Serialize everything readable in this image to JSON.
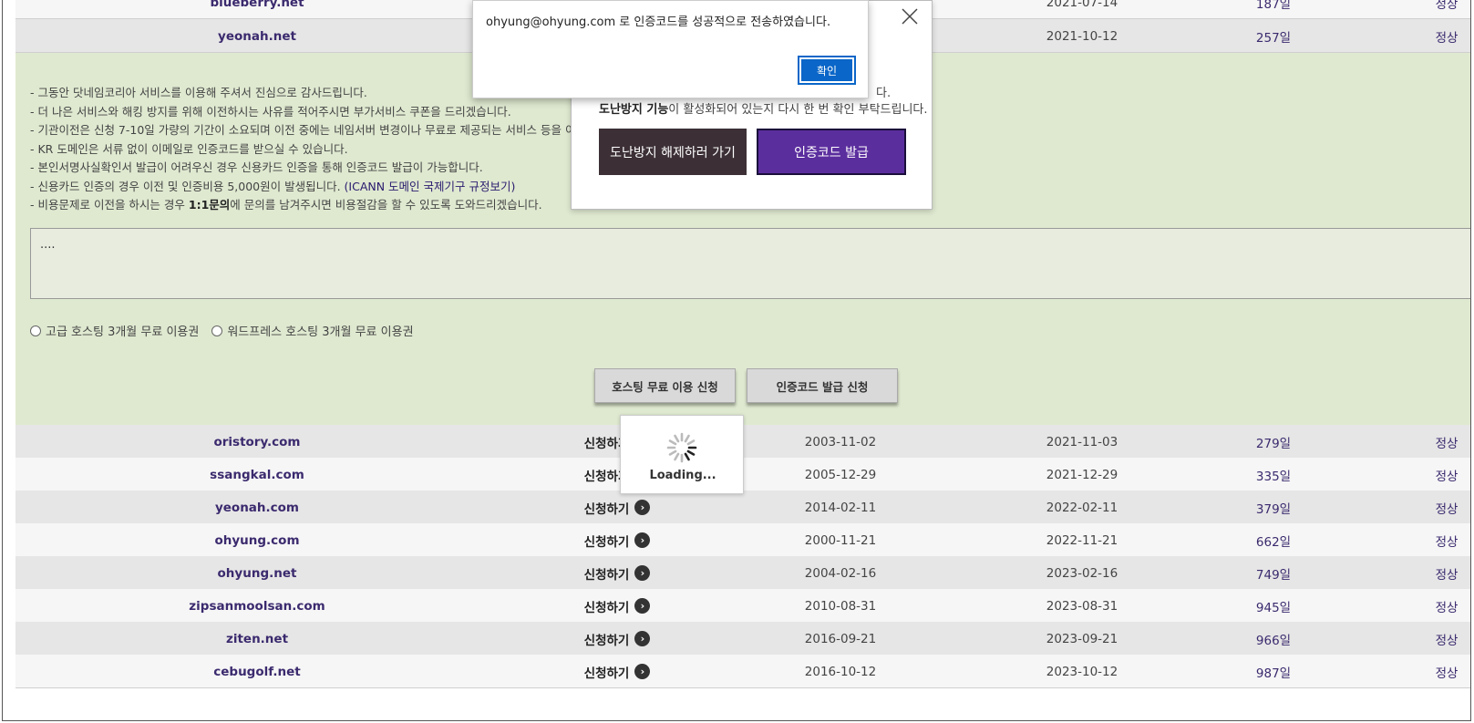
{
  "top_rows": [
    {
      "domain": "blueberry.net",
      "expire": "2021-07-14",
      "days": "187일",
      "status": "정상"
    },
    {
      "domain": "yeonah.net",
      "expire": "2021-10-12",
      "days": "257일",
      "status": "정상"
    }
  ],
  "notice": {
    "lines": [
      "- 그동안 닷네임코리아 서비스를 이용해 주셔서 진심으로 감사드립니다.",
      "- 더 나은 서비스와 해킹 방지를 위해 이전하시는 사유를 적어주시면 부가서비스 쿠폰을 드리겠습니다.",
      "- 기관이전은 신청 7-10일 가량의 기간이 소요되며 이전 중에는 네임서버 변경이나 무료로 제공되는 서비스 등을 이용할",
      "- KR 도메인은 서류 없이 이메일로 인증코드를 받으실 수 있습니다.",
      "- 본인서명사실확인서 발급이 어려우신 경우 신용카드 인증을 통해 인증코드 발급이 가능합니다."
    ],
    "line6_prefix": "- 신용카드 인증의 경우 이전 및 인증비용 5,000원이 발생됩니다. ",
    "line6_link": "(ICANN 도메인 국제기구 규정보기)",
    "line7_prefix": "- 비용문제로 이전을 하시는 경우 ",
    "line7_bold": "1:1문의",
    "line7_suffix": "에 문의를 남겨주시면 비용절감을 할 수 있도록 도와드리겠습니다."
  },
  "reason_box": {
    "value": "...."
  },
  "radios": [
    {
      "label": "고급 호스팅 3개월 무료 이용권"
    },
    {
      "label": "워드프레스 호스팅 3개월 무료 이용권"
    }
  ],
  "panel_buttons": {
    "hosting": "호스팅 무료 이용 신청",
    "authcode": "인증코드 발급 신청"
  },
  "rows": [
    {
      "domain": "oristory.com",
      "apply": "신청하기",
      "reg": "2003-11-02",
      "exp": "2021-11-03",
      "days": "279일",
      "status": "정상"
    },
    {
      "domain": "ssangkal.com",
      "apply": "신청하기",
      "reg": "2005-12-29",
      "exp": "2021-12-29",
      "days": "335일",
      "status": "정상"
    },
    {
      "domain": "yeonah.com",
      "apply": "신청하기",
      "reg": "2014-02-11",
      "exp": "2022-02-11",
      "days": "379일",
      "status": "정상"
    },
    {
      "domain": "ohyung.com",
      "apply": "신청하기",
      "reg": "2000-11-21",
      "exp": "2022-11-21",
      "days": "662일",
      "status": "정상"
    },
    {
      "domain": "ohyung.net",
      "apply": "신청하기",
      "reg": "2004-02-16",
      "exp": "2023-02-16",
      "days": "749일",
      "status": "정상"
    },
    {
      "domain": "zipsanmoolsan.com",
      "apply": "신청하기",
      "reg": "2010-08-31",
      "exp": "2023-08-31",
      "days": "945일",
      "status": "정상"
    },
    {
      "domain": "ziten.net",
      "apply": "신청하기",
      "reg": "2016-09-21",
      "exp": "2023-09-21",
      "days": "966일",
      "status": "정상"
    },
    {
      "domain": "cebugolf.net",
      "apply": "신청하기",
      "reg": "2016-10-12",
      "exp": "2023-10-12",
      "days": "987일",
      "status": "정상"
    }
  ],
  "modal": {
    "cut_text": "다.",
    "line_bold": "도난방지 기능",
    "line_rest": "이 활성화되어 있는지 다시 한 번 확인 부탁드립니다.",
    "btn_unlock": "도난방지 해제하러 가기",
    "btn_issue": "인증코드 발급"
  },
  "alert": {
    "message": "ohyung@ohyung.com 로 인증코드를 성공적으로 전송하였습니다.",
    "ok": "확인"
  },
  "loading": {
    "text": "Loading..."
  },
  "colors": {
    "accent_purple": "#5b2e9e",
    "ok_blue": "#0a66c8",
    "panel_green": "#dfe9d0"
  }
}
